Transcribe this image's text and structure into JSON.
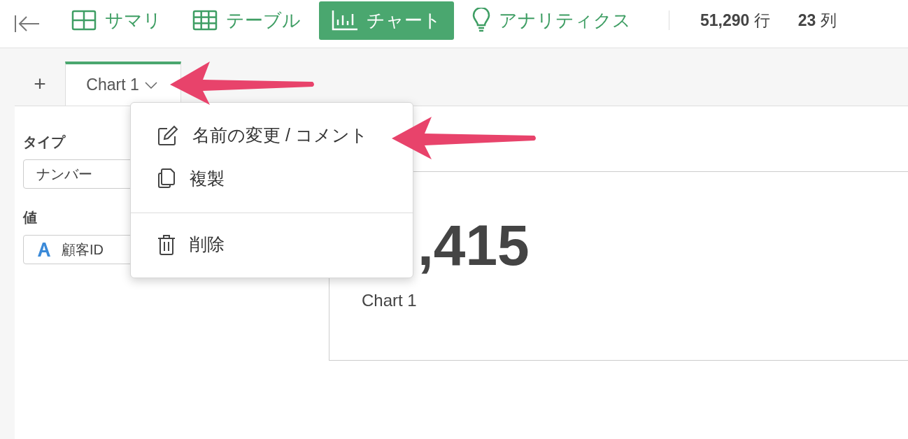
{
  "toolbar": {
    "nav": [
      {
        "label": "サマリ",
        "selected": false
      },
      {
        "label": "テーブル",
        "selected": false
      },
      {
        "label": "チャート",
        "selected": true
      },
      {
        "label": "アナリティクス",
        "selected": false
      }
    ],
    "stats": [
      {
        "value": "51,290",
        "unit": "行"
      },
      {
        "value": "23",
        "unit": "列"
      }
    ]
  },
  "add_tab": {
    "label": "+"
  },
  "chart_tabs": [
    {
      "label": "Chart 1",
      "selected": true
    }
  ],
  "config": {
    "type_label": "タイプ",
    "type_value": "ナンバー",
    "value_label": "値",
    "value_field": "顧客ID"
  },
  "chart": {
    "value": ",415",
    "caption": "Chart 1"
  },
  "menu": {
    "sections": [
      [
        {
          "label": "名前の変更 / コメント"
        },
        {
          "label": "複製"
        }
      ],
      [
        {
          "label": "削除"
        }
      ]
    ]
  }
}
